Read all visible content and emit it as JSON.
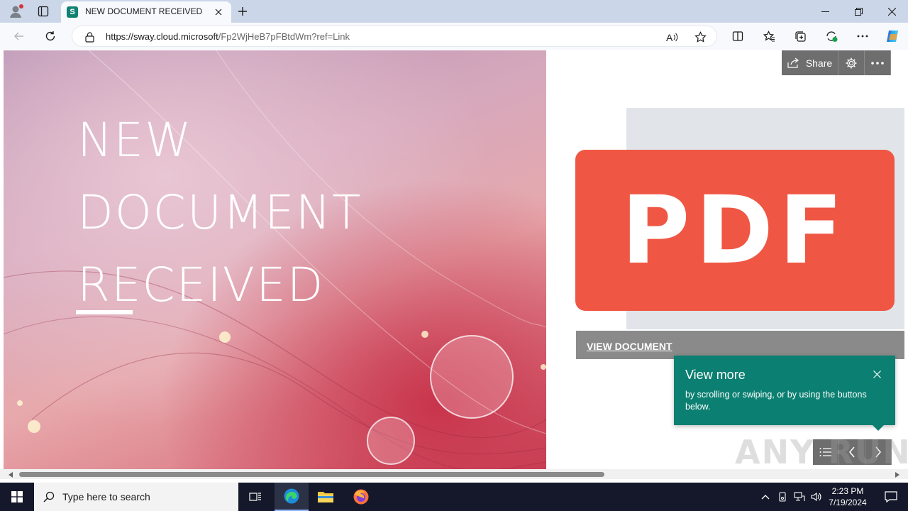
{
  "browser": {
    "tab_title": "NEW DOCUMENT RECEIVED",
    "tab_favicon_letter": "S",
    "url_host": "https://sway.cloud.microsoft",
    "url_path": "/Fp2WjHeB7pFBtdWm?ref=Link",
    "icons": [
      "profile-icon",
      "tab-actions-icon",
      "new-tab-icon",
      "back-icon",
      "refresh-icon",
      "lock-icon",
      "read-aloud-icon",
      "favorite-star-icon",
      "split-screen-icon",
      "favorites-icon",
      "collections-icon",
      "extensions-icon",
      "more-icon",
      "copilot-icon"
    ]
  },
  "sway": {
    "hero_title_lines": [
      "NEW",
      "DOCUMENT",
      "RECEIVED"
    ],
    "share_label": "Share",
    "pdf_label": "PDF",
    "view_document_label": "VIEW DOCUMENT",
    "tooltip": {
      "title": "View more",
      "body": "by scrolling or swiping, or by using the buttons below."
    },
    "watermark": "ANY RUN"
  },
  "taskbar": {
    "search_placeholder": "Type here to search",
    "time": "2:23 PM",
    "date": "7/19/2024"
  },
  "colors": {
    "pdf_red": "#ef5744",
    "tooltip_teal": "#0b7f71",
    "taskbar_bg": "#14182a"
  }
}
